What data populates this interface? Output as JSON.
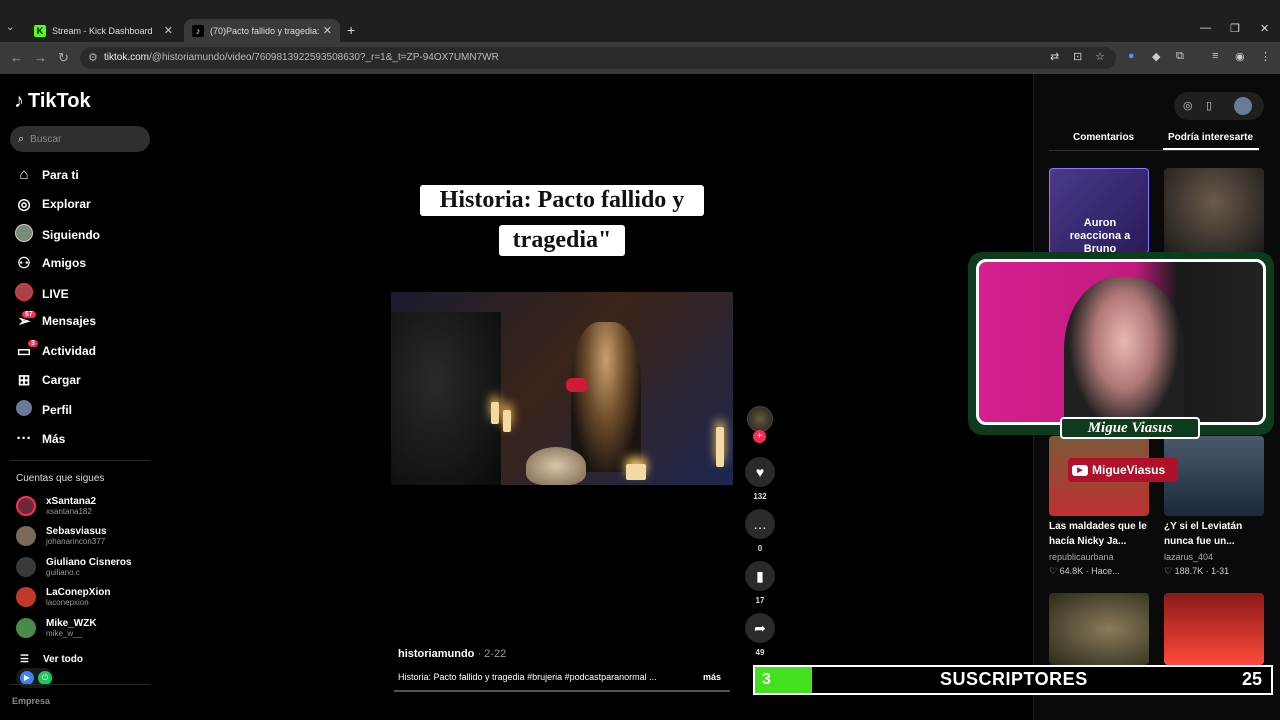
{
  "browser": {
    "tabs": [
      {
        "title": "Stream - Kick Dashboard",
        "favicon": "K"
      },
      {
        "title": "(70)Pacto fallido y tragedia: un...",
        "favicon": "♪"
      }
    ],
    "url_host": "tiktok.com",
    "url_path": "/@historiamundo/video/7609813922593508630?_r=1&_t=ZP-94OX7UMN7WR"
  },
  "sidebar": {
    "logo": "TikTok",
    "search_placeholder": "Buscar",
    "nav": [
      {
        "label": "Para ti",
        "icon": "home-icon"
      },
      {
        "label": "Explorar",
        "icon": "compass-icon"
      },
      {
        "label": "Siguiendo",
        "icon": "following-icon"
      },
      {
        "label": "Amigos",
        "icon": "friends-icon"
      },
      {
        "label": "LIVE",
        "icon": "live-icon"
      },
      {
        "label": "Mensajes",
        "icon": "messages-icon",
        "badge": "67"
      },
      {
        "label": "Actividad",
        "icon": "activity-icon",
        "badge": "3"
      },
      {
        "label": "Cargar",
        "icon": "upload-icon"
      },
      {
        "label": "Perfil",
        "icon": "profile-icon"
      },
      {
        "label": "Más",
        "icon": "more-icon"
      }
    ],
    "following_title": "Cuentas que sigues",
    "accounts": [
      {
        "name": "xSantana2",
        "handle": "xsantana182"
      },
      {
        "name": "Sebasviasus",
        "handle": "johanarincon377"
      },
      {
        "name": "Giuliano Cisneros",
        "handle": "guiliano.c"
      },
      {
        "name": "LaConepXion",
        "handle": "laconepxion"
      },
      {
        "name": "Mike_WZK",
        "handle": "mike_w__"
      }
    ],
    "see_all": "Ver todo",
    "footer": "Empresa"
  },
  "video": {
    "caption_line1": "Historia: Pacto fallido y",
    "caption_line2": "tragedia\"",
    "author": "historiamundo",
    "date": " · 2-22",
    "description": "Historia: Pacto fallido y tragedia #brujeria #podcastparanormal ...",
    "more": "más",
    "likes": "132",
    "comments": "0",
    "saves": "17",
    "shares": "49"
  },
  "right_panel": {
    "tab_comments": "Comentarios",
    "tab_suggested": "Podría interesarte",
    "thumbs": [
      {
        "title": "Las maldades que le hacía Nicky Ja...",
        "user": "republicaurbana",
        "likes": "♡ 64.8K · Hace..."
      },
      {
        "title": "¿Y si el Leviatán nunca fue un...",
        "user": "lazarus_404",
        "likes": "♡ 188.7K · 1-31"
      }
    ],
    "thumb_text_1": "Auron reacciona a Bruno"
  },
  "overlay": {
    "streamer_name": "Migue Viasus",
    "youtube_handle": "MigueViasus",
    "sub_current": "3",
    "sub_label": "SUSCRIPTORES",
    "sub_goal": "25",
    "sub_fraction": 0.12
  }
}
